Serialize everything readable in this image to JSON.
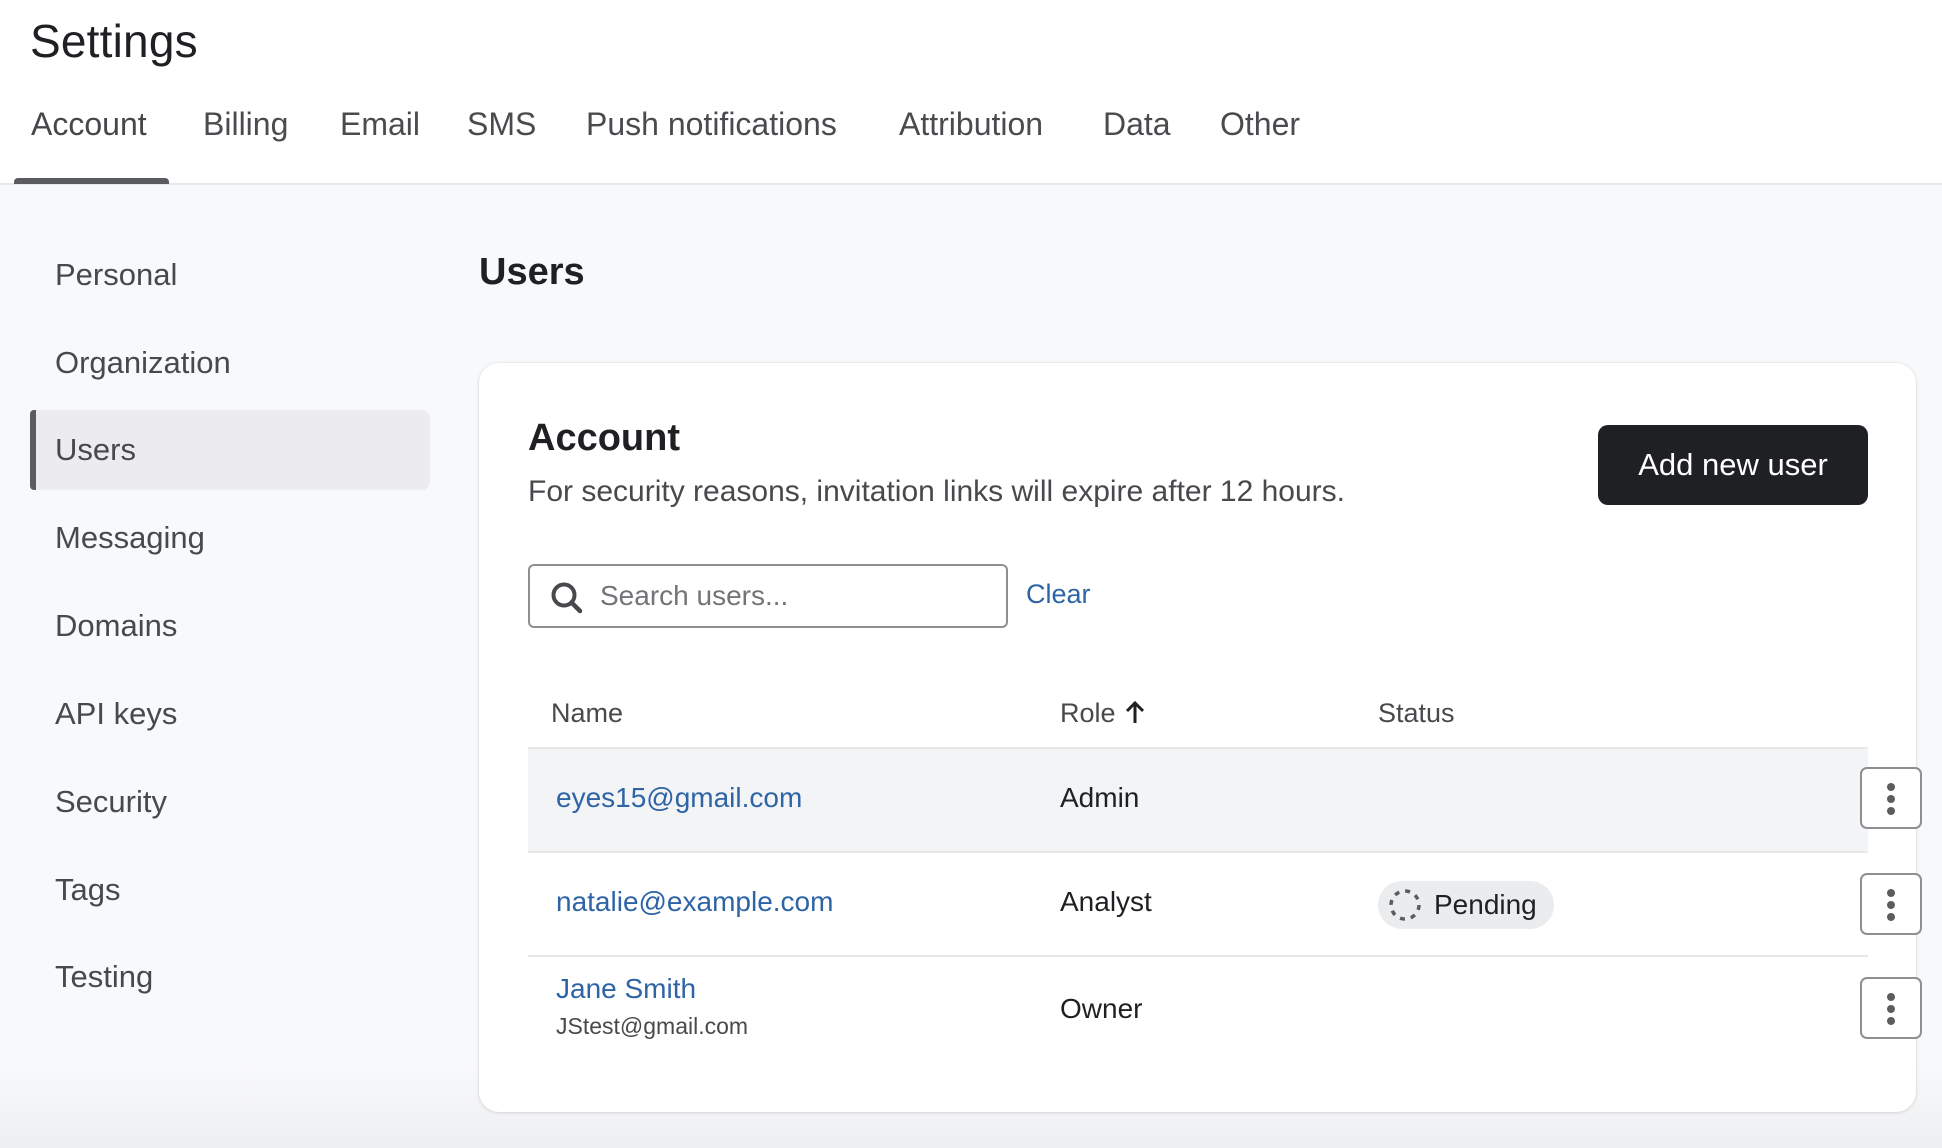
{
  "header": {
    "title": "Settings",
    "tabs": [
      {
        "label": "Account",
        "active": true
      },
      {
        "label": "Billing"
      },
      {
        "label": "Email"
      },
      {
        "label": "SMS"
      },
      {
        "label": "Push notifications"
      },
      {
        "label": "Attribution"
      },
      {
        "label": "Data"
      },
      {
        "label": "Other"
      }
    ]
  },
  "sidebar": {
    "items": [
      {
        "label": "Personal"
      },
      {
        "label": "Organization"
      },
      {
        "label": "Users",
        "active": true
      },
      {
        "label": "Messaging"
      },
      {
        "label": "Domains"
      },
      {
        "label": "API keys"
      },
      {
        "label": "Security"
      },
      {
        "label": "Tags"
      },
      {
        "label": "Testing"
      }
    ]
  },
  "main": {
    "section_title": "Users",
    "card": {
      "title": "Account",
      "description": "For security reasons, invitation links will expire after 12 hours.",
      "add_button_label": "Add new user",
      "search": {
        "placeholder": "Search users...",
        "value": "",
        "icon": "search-icon"
      },
      "clear_label": "Clear",
      "table": {
        "columns": {
          "name": "Name",
          "role": "Role",
          "status": "Status",
          "role_sort": "ascending"
        },
        "rows": [
          {
            "name": "eyes15@gmail.com",
            "sub": "",
            "role": "Admin",
            "status": "",
            "highlighted": true
          },
          {
            "name": "natalie@example.com",
            "sub": "",
            "role": "Analyst",
            "status": "Pending"
          },
          {
            "name": "Jane Smith",
            "sub": "JStest@gmail.com",
            "role": "Owner",
            "status": ""
          }
        ]
      }
    }
  },
  "colors": {
    "primary_button": "#1f2023",
    "link": "#2e64a6",
    "page_bg": "#f8f9fb",
    "row_highlight": "#f3f4f6",
    "badge_bg": "#ebecee"
  }
}
